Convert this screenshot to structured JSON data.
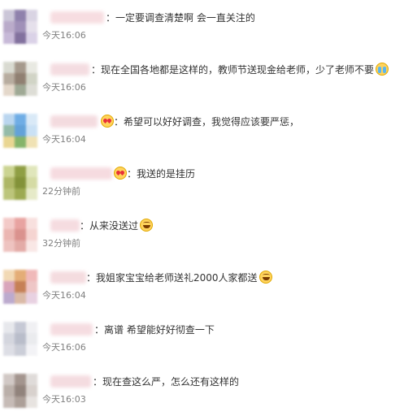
{
  "comments": [
    {
      "text": "：一定要调查清楚啊 会一直关注的",
      "time": "今天16:06",
      "emoji": "",
      "avatar_colors": [
        "#c9c3d6",
        "#8a7ba8",
        "#d8d2e2",
        "#b7a7c8",
        "#9b8bb5",
        "#e4dfea",
        "#c5b6d6",
        "#7c6a99",
        "#d9d0e6"
      ],
      "name_color": "#f6d8dc"
    },
    {
      "text": "：现在全国各地都是这样的，教师节送现金给老师，少了老师不要",
      "time": "今天16:06",
      "emoji": "cry",
      "avatar_colors": [
        "#d7d9cf",
        "#a19486",
        "#e7e8e1",
        "#b4a89a",
        "#8b7a6b",
        "#cfd2c4",
        "#e3d6c8",
        "#9aa590",
        "#dcdcd4"
      ],
      "name_color": "#f3d7dc"
    },
    {
      "text": "：希望可以好好调查，我觉得应该要严惩，",
      "time": "今天16:04",
      "emoji": "heart-before",
      "avatar_colors": [
        "#b7d4ef",
        "#68a9e4",
        "#d8e8f7",
        "#8fb8a5",
        "#5b9ed8",
        "#c8e0f5",
        "#e8d48d",
        "#7fb063",
        "#f0e1b0"
      ],
      "name_color": "#f2d5da"
    },
    {
      "text": "：我送的是挂历",
      "time": "22分钟前",
      "emoji": "heart-before",
      "avatar_colors": [
        "#c9d28c",
        "#8a9a3b",
        "#dfe5b8",
        "#aab45e",
        "#7d8d2f",
        "#d3daa0",
        "#b9c274",
        "#98a649",
        "#e5e9c6"
      ],
      "name_color": "#f5d5db"
    },
    {
      "text": "：从来没送过",
      "time": "32分钟前",
      "emoji": "laugh",
      "avatar_colors": [
        "#f3c8c6",
        "#e79f9c",
        "#f8dfdd",
        "#eab3ae",
        "#d98d89",
        "#f5d2cf",
        "#eec0bd",
        "#e2a7a3",
        "#f9e6e4"
      ],
      "name_color": "#f4d6db"
    },
    {
      "text": "：我姐家宝宝给老师送礼2000人家都送",
      "time": "今天16:04",
      "emoji": "laugh",
      "avatar_colors": [
        "#f2d7b2",
        "#e3a970",
        "#f0b6b6",
        "#d7a1b8",
        "#c37a4e",
        "#eec3c3",
        "#b9a6cc",
        "#d9b7a3",
        "#e7cfe0"
      ],
      "name_color": "#f3d6da"
    },
    {
      "text": "：离谱 希望能好好彻查一下",
      "time": "今天16:06",
      "emoji": "",
      "avatar_colors": [
        "#e6e7ec",
        "#c4c7d3",
        "#f0f0f3",
        "#d2d4dd",
        "#b6bac8",
        "#e9eaee",
        "#dcdde4",
        "#c9ccd6",
        "#f3f3f6"
      ],
      "name_color": "#f4d7dc"
    },
    {
      "text": "：现在查这么严，怎么还有这样的",
      "time": "今天16:03",
      "emoji": "",
      "avatar_colors": [
        "#cfc6c2",
        "#9f9089",
        "#dedad7",
        "#b7aba5",
        "#8c7d76",
        "#d6cfcb",
        "#c3b8b3",
        "#a89a93",
        "#e6e2df"
      ],
      "name_color": "#f3d6db"
    }
  ]
}
